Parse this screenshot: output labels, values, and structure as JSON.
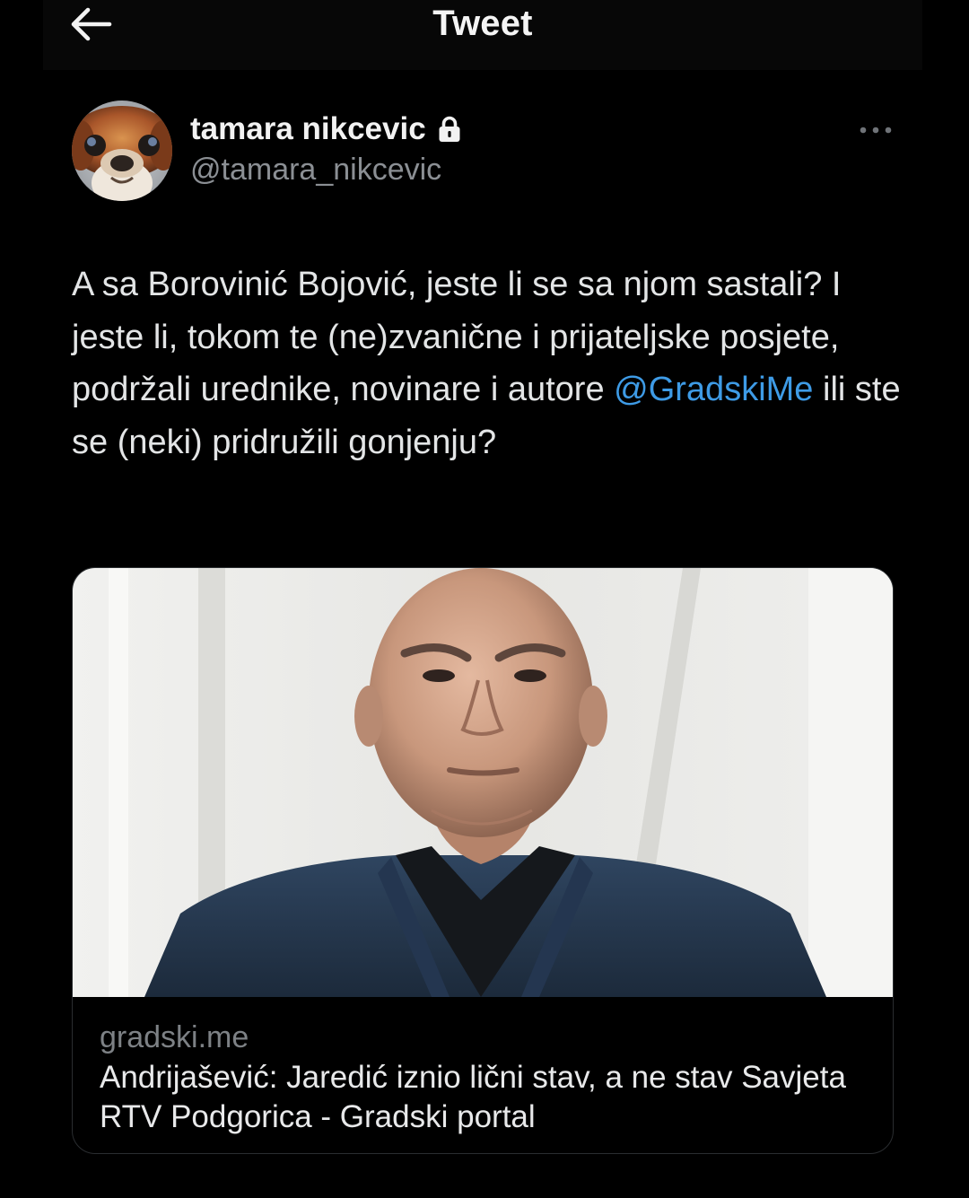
{
  "header": {
    "title": "Tweet",
    "back_icon": "arrow-left-icon"
  },
  "tweet": {
    "author": {
      "name": "tamara nikcevic",
      "handle": "@tamara_nikcevic",
      "protected_icon": "lock-icon",
      "avatar": "avatar-photo"
    },
    "more_icon": "more-dots-icon",
    "text_before_mention": "A sa Borovinić Bojović, jeste li se sa njom sastali? I jeste li, tokom te (ne)zvanične i prijateljske posjete, podržali urednike, novinare i autore ",
    "mention": "@GradskiMe",
    "text_after_mention": " ili ste se (neki) pridružili gonjenju?",
    "link_card": {
      "domain": "gradski.me",
      "title": "Andrijašević: Jaredić iznio lični stav, a ne stav Savjeta RTV Podgorica - Gradski portal"
    }
  },
  "colors": {
    "background": "#000000",
    "text": "#e7e9ea",
    "secondary_text": "#8b8f94",
    "link": "#3e9be6",
    "card_border": "#2a2d30"
  }
}
